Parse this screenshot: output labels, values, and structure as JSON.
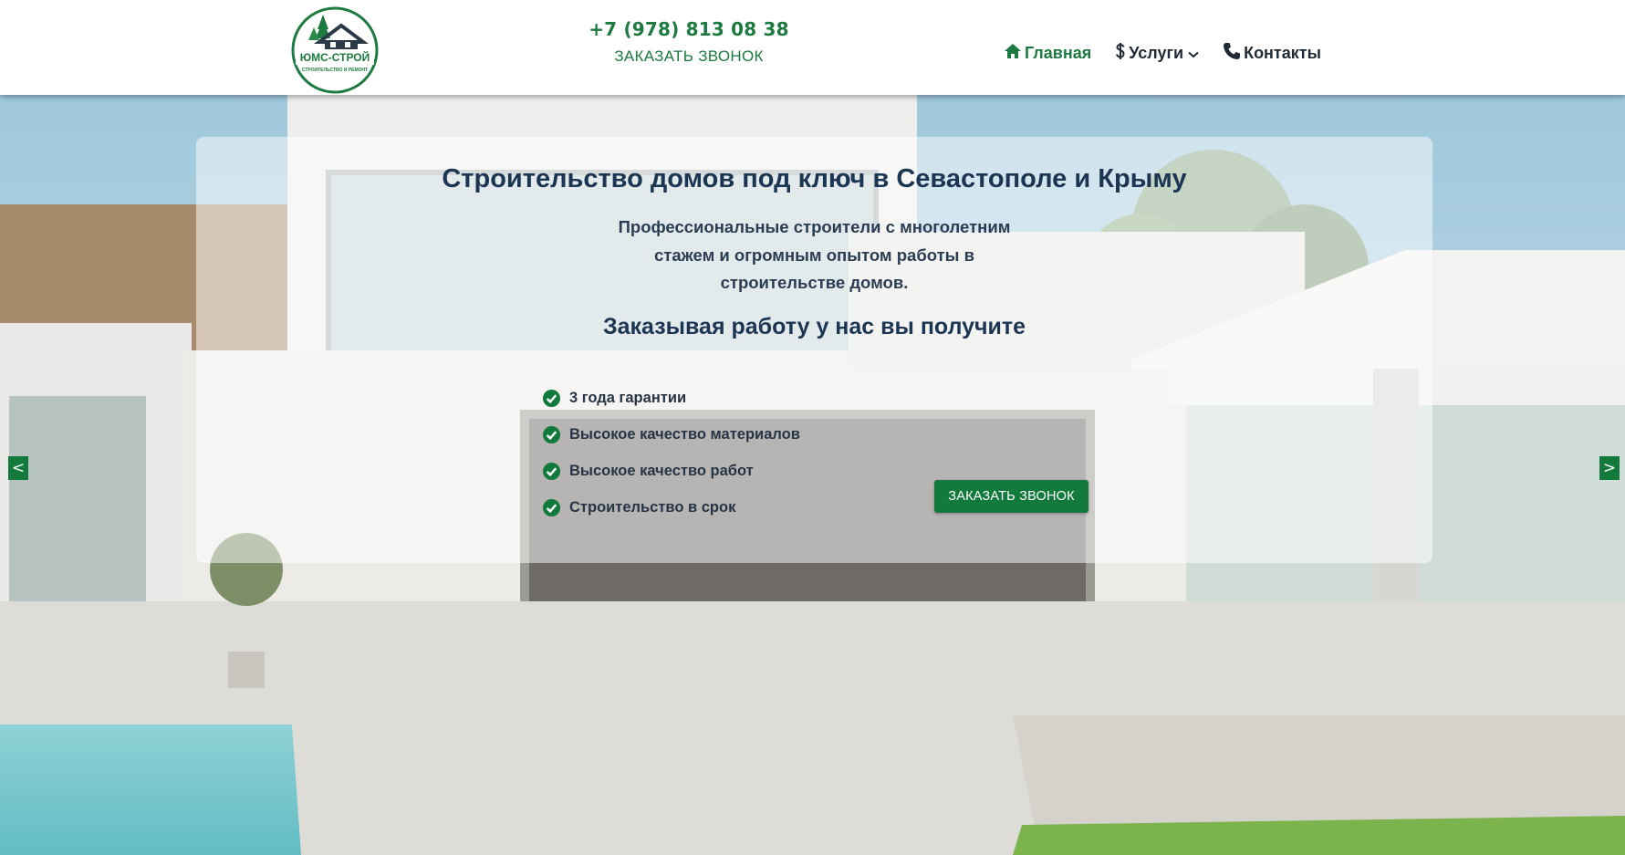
{
  "header": {
    "logo": {
      "brand": "ЮМС-СТРОЙ",
      "tagline": "строительство и ремонт"
    },
    "phone": "+7 (978) 813 08 38",
    "callback_link": "ЗАКАЗАТЬ ЗВОНОК",
    "nav": {
      "home": "Главная",
      "services": "Услуги",
      "contacts": "Контакты"
    }
  },
  "hero": {
    "title": "Строительство домов под ключ в Севастополе и Крыму",
    "subtitle": "Профессиональные строители с многолетним стажем и огромным опытом работы в строительстве домов.",
    "benefits_title": "Заказывая работу у нас вы получите",
    "benefits": [
      "3 года гарантии",
      "Высокое качество материалов",
      "Высокое качество работ",
      "Строительство в срок"
    ],
    "cta_button": "ЗАКАЗАТЬ ЗВОНОК",
    "prev_arrow": "<",
    "next_arrow": ">"
  },
  "colors": {
    "brand_green": "#127a3c",
    "heading_navy": "#1b3552",
    "text_dark": "#1f2a35"
  },
  "icons": {
    "home": "home-icon",
    "services": "dollar-icon",
    "services_caret": "chevron-down-icon",
    "contacts": "phone-icon",
    "benefit": "check-circle-icon"
  }
}
